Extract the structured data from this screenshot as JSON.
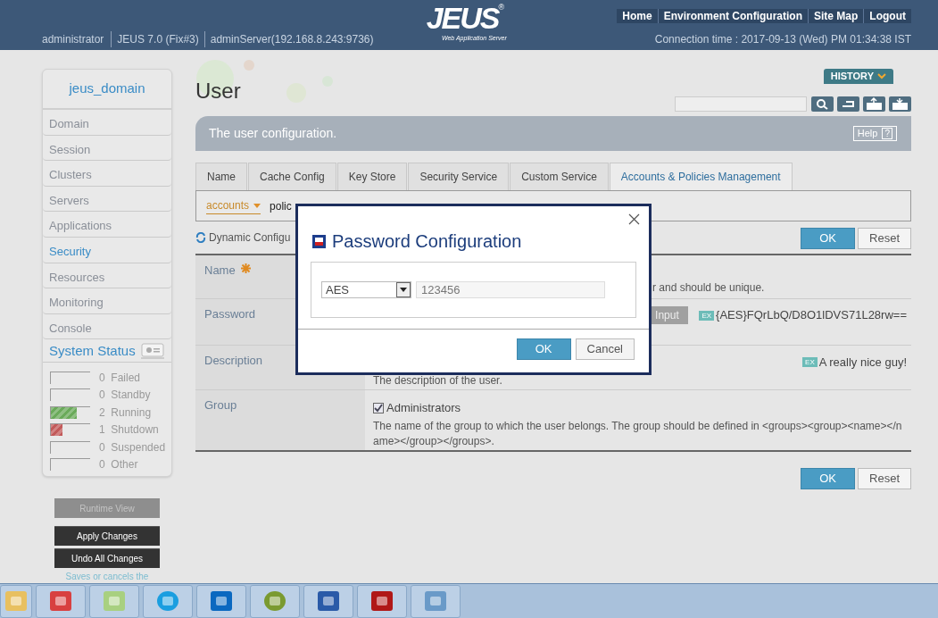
{
  "header": {
    "logo": "JEUS",
    "logo_mark": "®",
    "logo_subtitle": "Web Application Server",
    "nav": [
      "Home",
      "Environment Configuration",
      "Site Map",
      "Logout"
    ],
    "info": [
      "administrator",
      "JEUS 7.0 (Fix#3)",
      "adminServer(192.168.8.243:9736)"
    ],
    "connection": "Connection time : 2017-09-13 (Wed) PM 01:34:38 IST"
  },
  "sidebar": {
    "domain": "jeus_domain",
    "items": [
      {
        "label": "Domain",
        "selected": false
      },
      {
        "label": "Session",
        "selected": false
      },
      {
        "label": "Clusters",
        "selected": false
      },
      {
        "label": "Servers",
        "selected": false
      },
      {
        "label": "Applications",
        "selected": false
      },
      {
        "label": "Security",
        "selected": true
      },
      {
        "label": "Resources",
        "selected": false
      },
      {
        "label": "Monitoring",
        "selected": false
      },
      {
        "label": "Console",
        "selected": false
      }
    ],
    "status_title": "System Status",
    "status": [
      {
        "count": "0",
        "label": "Failed",
        "level": 0
      },
      {
        "count": "0",
        "label": "Standby",
        "level": 0
      },
      {
        "count": "2",
        "label": "Running",
        "level": 0.65,
        "color": "#6aaa5a"
      },
      {
        "count": "1",
        "label": "Shutdown",
        "level": 0.3,
        "color": "#c25a5a"
      },
      {
        "count": "0",
        "label": "Suspended",
        "level": 0
      },
      {
        "count": "0",
        "label": "Other",
        "level": 0
      }
    ],
    "buttons": [
      {
        "label": "Runtime View",
        "disabled": true
      },
      {
        "label": "Apply Changes",
        "disabled": false
      },
      {
        "label": "Undo All Changes",
        "disabled": false
      }
    ],
    "note": "Saves or cancels the"
  },
  "main": {
    "title": "User",
    "history": "HISTORY",
    "banner": "The user configuration.",
    "help": "Help",
    "help_mark": "?",
    "tabs": [
      {
        "label": "Name",
        "selected": false
      },
      {
        "label": "Cache Config",
        "selected": false
      },
      {
        "label": "Key Store",
        "selected": false
      },
      {
        "label": "Security Service",
        "selected": false
      },
      {
        "label": "Custom Service",
        "selected": false
      },
      {
        "label": "Accounts & Policies Management",
        "selected": true
      }
    ],
    "subtabs": [
      {
        "label": "accounts",
        "selected": true
      },
      {
        "label": "polic",
        "selected": false
      }
    ],
    "dynamic": "Dynamic Configu",
    "actions": [
      "OK",
      "Reset"
    ],
    "rows": [
      {
        "kind": "text",
        "label": "Name",
        "required": true,
        "description": "r and should be unique."
      },
      {
        "kind": "password",
        "label": "Password",
        "required": false,
        "button": "Input",
        "badge": "EX",
        "example": "{AES}FQrLbQ/D8O1lDVS71L28rw=="
      },
      {
        "kind": "example",
        "label": "Description",
        "required": false,
        "badge": "EX",
        "example": "A really nice guy!",
        "description": "The description of the user."
      },
      {
        "kind": "checkbox",
        "label": "Group",
        "required": false,
        "option": "Administrators",
        "checked": true,
        "description": "The name of the group to which the user belongs. The group should be defined in <groups><group><name></name></group></groups>."
      }
    ],
    "bottom_actions": [
      "OK",
      "Reset"
    ]
  },
  "dialog": {
    "title": "Password Configuration",
    "algorithm": "AES",
    "value": "123456",
    "buttons": [
      "OK",
      "Cancel"
    ]
  }
}
